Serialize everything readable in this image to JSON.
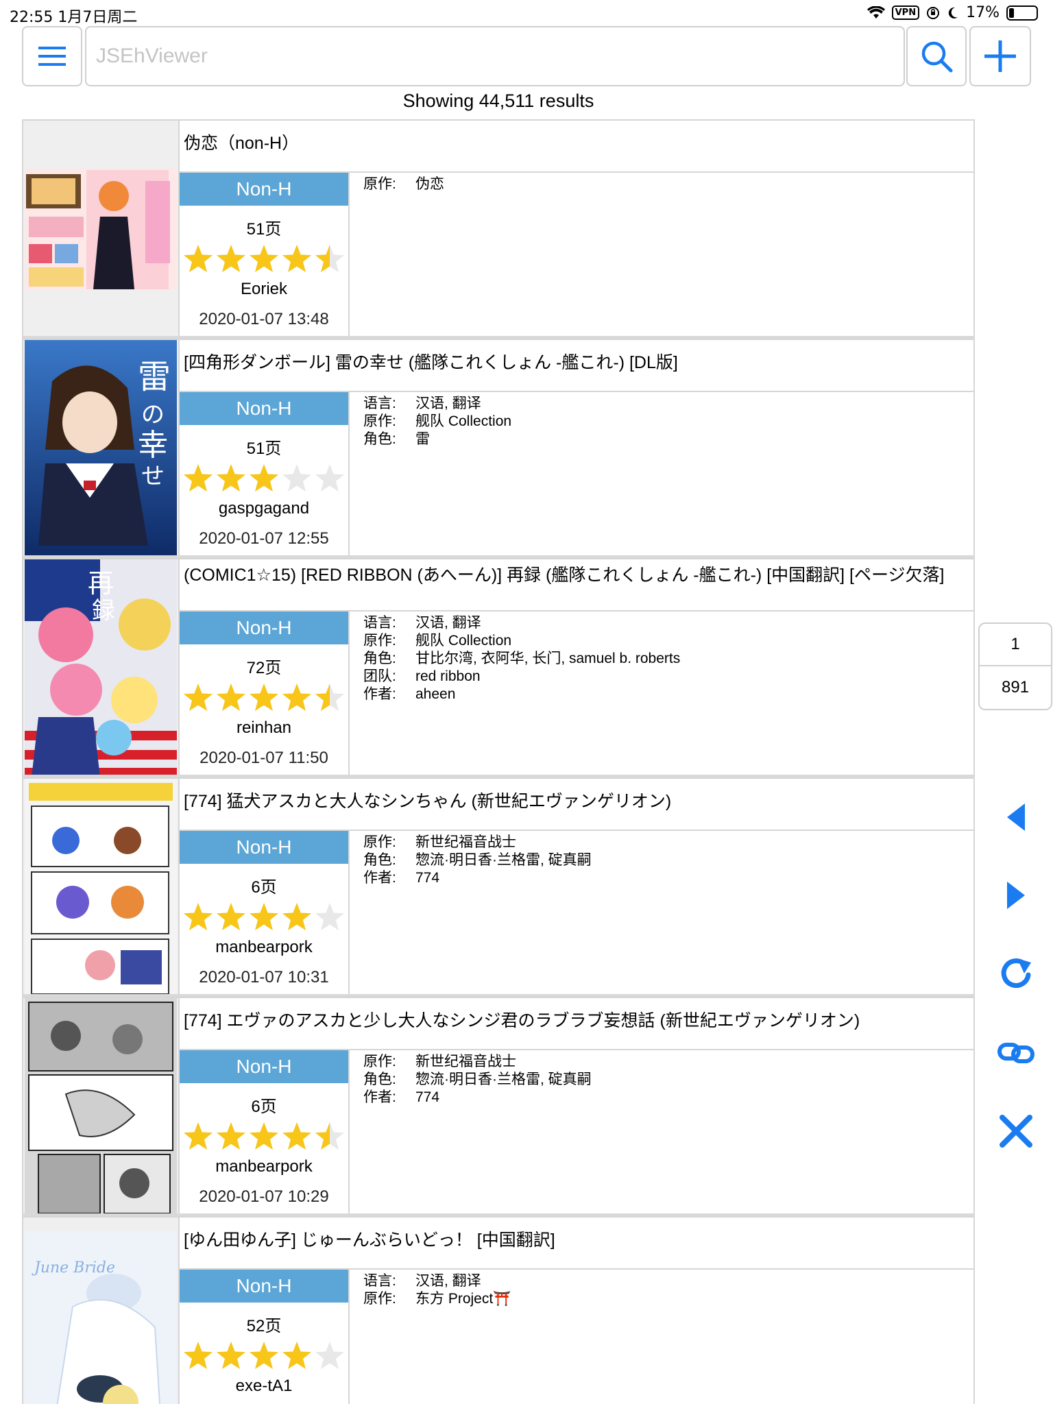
{
  "status_bar": {
    "time_date": "22:55   1月7日周二",
    "vpn": "VPN",
    "battery": "17%"
  },
  "toolbar": {
    "search_placeholder": "JSEhViewer"
  },
  "results": {
    "count_text": "Showing 44,511 results"
  },
  "galleries": [
    {
      "title": "伪恋（non-H）",
      "category": "Non-H",
      "pages": "51页",
      "rating": 4.5,
      "uploader": "Eoriek",
      "posted": "2020-01-07 13:48",
      "tags": [
        {
          "ns": "原作:",
          "values": "伪恋"
        }
      ]
    },
    {
      "title": "[四角形ダンボール] 雷の幸せ (艦隊これくしょん -艦これ-) [DL版]",
      "category": "Non-H",
      "pages": "51页",
      "rating": 3,
      "uploader": "gaspgagand",
      "posted": "2020-01-07 12:55",
      "tags": [
        {
          "ns": "语言:",
          "values": "汉语, 翻译"
        },
        {
          "ns": "原作:",
          "values": "舰队 Collection"
        },
        {
          "ns": "角色:",
          "values": "雷"
        }
      ]
    },
    {
      "title": "(COMIC1☆15) [RED RIBBON (あへーん)] 再録 (艦隊これくしょん -艦これ-) [中国翻訳] [ページ欠落]",
      "category": "Non-H",
      "pages": "72页",
      "rating": 4.5,
      "uploader": "reinhan",
      "posted": "2020-01-07 11:50",
      "tags": [
        {
          "ns": "语言:",
          "values": "汉语, 翻译"
        },
        {
          "ns": "原作:",
          "values": "舰队 Collection"
        },
        {
          "ns": "角色:",
          "values": "甘比尔湾, 衣阿华, 长门, samuel b. roberts"
        },
        {
          "ns": "团队:",
          "values": "red ribbon"
        },
        {
          "ns": "作者:",
          "values": "aheen"
        }
      ]
    },
    {
      "title": "[774] 猛犬アスカと大人なシンちゃん (新世紀エヴァンゲリオン)",
      "category": "Non-H",
      "pages": "6页",
      "rating": 4,
      "uploader": "manbearpork",
      "posted": "2020-01-07 10:31",
      "tags": [
        {
          "ns": "原作:",
          "values": "新世纪福音战士"
        },
        {
          "ns": "角色:",
          "values": "惣流·明日香·兰格雷, 碇真嗣"
        },
        {
          "ns": "作者:",
          "values": "774"
        }
      ]
    },
    {
      "title": "[774] エヴァのアスカと少し大人なシンジ君のラブラブ妄想話 (新世紀エヴァンゲリオン)",
      "category": "Non-H",
      "pages": "6页",
      "rating": 4.5,
      "uploader": "manbearpork",
      "posted": "2020-01-07 10:29",
      "tags": [
        {
          "ns": "原作:",
          "values": "新世纪福音战士"
        },
        {
          "ns": "角色:",
          "values": "惣流·明日香·兰格雷, 碇真嗣"
        },
        {
          "ns": "作者:",
          "values": "774"
        }
      ]
    },
    {
      "title": "[ゆん田ゆん子] じゅーんぶらいどっ！ [中国翻訳]",
      "category": "Non-H",
      "pages": "52页",
      "rating": 4,
      "uploader": "exe-tA1",
      "posted": "",
      "tags": [
        {
          "ns": "语言:",
          "values": "汉语, 翻译"
        },
        {
          "ns": "原作:",
          "values": "东方 Project⛩️"
        }
      ]
    }
  ],
  "pagination": {
    "current": "1",
    "total": "891"
  },
  "colors": {
    "accent": "#1a7cf0",
    "category_non_h": "#5ba6d6",
    "star_fill": "#f7c619",
    "star_empty": "#e8e8e8"
  },
  "icons": {
    "menu": "menu-icon",
    "search": "search-icon",
    "add": "plus-icon",
    "prev": "triangle-left-icon",
    "next": "triangle-right-icon",
    "refresh": "refresh-icon",
    "link": "link-icon",
    "close": "close-icon"
  }
}
